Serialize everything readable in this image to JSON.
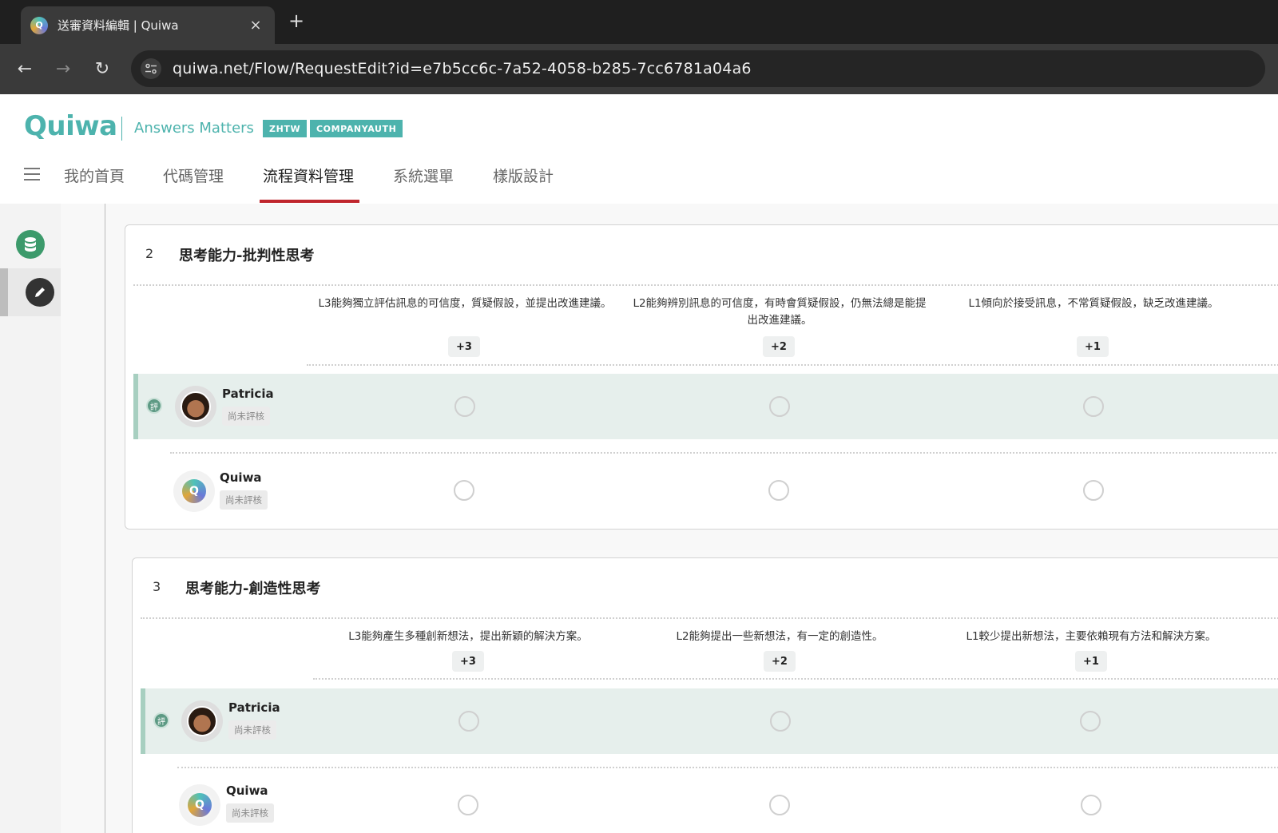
{
  "browser": {
    "tab_title": "送審資料編輯 | Quiwa",
    "tab_close": "×",
    "new_tab": "+",
    "back": "←",
    "forward": "→",
    "reload": "↻",
    "url": "quiwa.net/Flow/RequestEdit?id=e7b5cc6c-7a52-4058-b285-7cc6781a04a6"
  },
  "header": {
    "logo": "Quiwa",
    "tagline": "Answers Matters",
    "badges": [
      "ZHTW",
      "COMPANYAUTH"
    ],
    "nav": [
      "我的首頁",
      "代碼管理",
      "流程資料管理",
      "系統選單",
      "樣版設計"
    ],
    "active_nav": "流程資料管理"
  },
  "sections": [
    {
      "number": "2",
      "title": "思考能力-批判性思考",
      "criteria": [
        {
          "text": "L3能夠獨立評估訊息的可信度，質疑假設，並提出改進建議。",
          "score": "+3"
        },
        {
          "text": "L2能夠辨別訊息的可信度，有時會質疑假設，仍無法總是能提出改進建議。",
          "score": "+2"
        },
        {
          "text": "L1傾向於接受訊息，不常質疑假設，缺乏改進建議。",
          "score": "+1"
        }
      ],
      "reviewers": [
        {
          "name": "Patricia",
          "status": "尚未評核",
          "eval_mark": "評"
        },
        {
          "name": "Quiwa",
          "status": "尚未評核"
        }
      ]
    },
    {
      "number": "3",
      "title": "思考能力-創造性思考",
      "criteria": [
        {
          "text": "L3能夠產生多種創新想法，提出新穎的解決方案。",
          "score": "+3"
        },
        {
          "text": "L2能夠提出一些新想法，有一定的創造性。",
          "score": "+2"
        },
        {
          "text": "L1較少提出新想法，主要依賴現有方法和解決方案。",
          "score": "+1"
        }
      ],
      "reviewers": [
        {
          "name": "Patricia",
          "status": "尚未評核",
          "eval_mark": "評"
        },
        {
          "name": "Quiwa",
          "status": "尚未評核"
        }
      ]
    }
  ],
  "colors": {
    "brand": "#4db3ad",
    "active_underline": "#c0262d",
    "highlight_row": "#e6efec"
  }
}
